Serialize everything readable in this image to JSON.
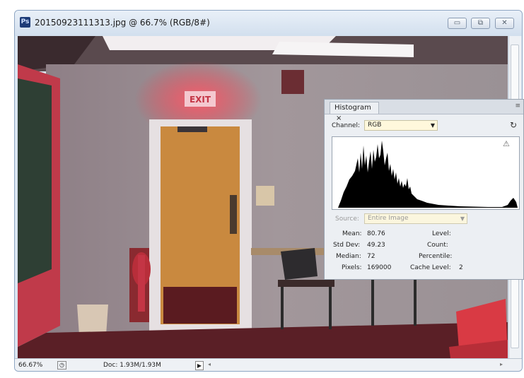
{
  "window": {
    "title": "20150923111313.jpg @ 66.7% (RGB/8#)",
    "app_icon": "Ps",
    "buttons": [
      "minimize-icon",
      "restore-icon",
      "close-icon"
    ]
  },
  "photo": {
    "sign_text": "EXIT"
  },
  "histogram_panel": {
    "tab_label": "Histogram",
    "tab_close": "×",
    "channel_label": "Channel:",
    "channel_value": "RGB",
    "source_label": "Source:",
    "source_value": "Entire Image",
    "stats": {
      "mean_label": "Mean:",
      "mean": "80.76",
      "std_label": "Std Dev:",
      "std": "49.23",
      "median_label": "Median:",
      "median": "72",
      "pixels_label": "Pixels:",
      "pixels": "169000",
      "level_label": "Level:",
      "count_label": "Count:",
      "percentile_label": "Percentile:",
      "cache_label": "Cache Level:",
      "cache": "2"
    }
  },
  "status": {
    "zoom": "66.67%",
    "doc": "Doc: 1.93M/1.93M"
  },
  "colors": {
    "titlebar": "#d2dfee",
    "wall": "#9b8d92",
    "floor": "#5a1f26",
    "door": "#c9893f"
  }
}
